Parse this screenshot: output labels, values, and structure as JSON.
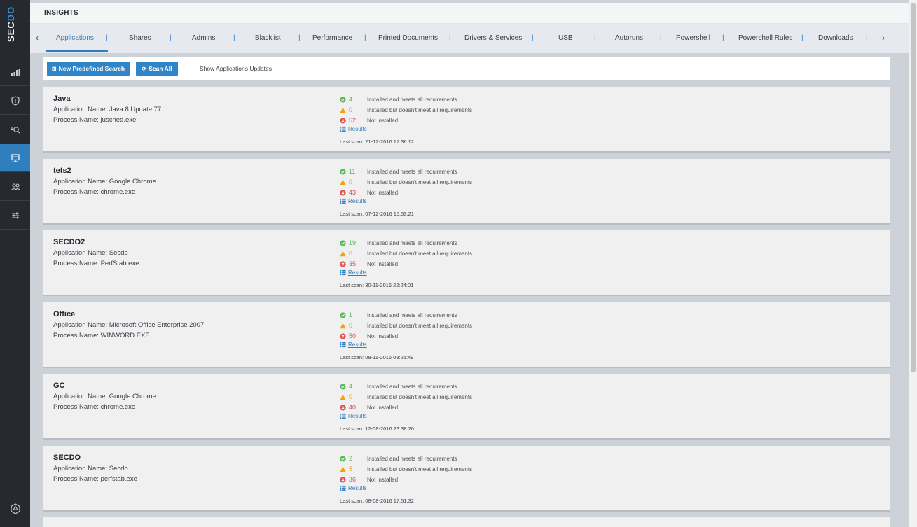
{
  "brand": {
    "logo_prefix": "SEC",
    "logo_suffix": "DO"
  },
  "header": {
    "title": "INSIGHTS"
  },
  "tabs": [
    {
      "label": "Applications"
    },
    {
      "label": "Shares"
    },
    {
      "label": "Admins"
    },
    {
      "label": "Blacklist"
    },
    {
      "label": "Performance"
    },
    {
      "label": "Printed Documents"
    },
    {
      "label": "Drivers & Services"
    },
    {
      "label": "USB"
    },
    {
      "label": "Autoruns"
    },
    {
      "label": "Powershell"
    },
    {
      "label": "Powershell Rules"
    },
    {
      "label": "Downloads"
    }
  ],
  "tab_separator": "|",
  "tab_arrows": {
    "left": "‹",
    "right": "›"
  },
  "toolbar": {
    "new_search_label": "New Predefined Search",
    "scan_all_label": "Scan All",
    "show_updates_label": "Show Applications Updates"
  },
  "labels": {
    "met": "Installed and meets all requirements",
    "partial": "Installed but doesn't meet all requirements",
    "missing": "Not installed",
    "results": "Results"
  },
  "cards": [
    {
      "title": "Java",
      "app_name": "Application Name: Java 8 Update 77",
      "process_name": "Process Name: jusched.exe",
      "met": "4",
      "partial": "0",
      "missing": "52",
      "last_scan": "Last scan: 21-12-2016 17:36:12"
    },
    {
      "title": "tets2",
      "app_name": "Application Name: Google Chrome",
      "process_name": "Process Name: chrome.exe",
      "met": "11",
      "partial": "0",
      "missing": "43",
      "last_scan": "Last scan: 07-12-2016 15:53:21"
    },
    {
      "title": "SECDO2",
      "app_name": "Application Name: Secdo",
      "process_name": "Process Name: PerfStab.exe",
      "met": "19",
      "partial": "0",
      "missing": "35",
      "last_scan": "Last scan: 30-11-2016 22:24:01"
    },
    {
      "title": "Office",
      "app_name": "Application Name: Microsoft Office Enterprise 2007",
      "process_name": "Process Name: WINWORD.EXE",
      "met": "1",
      "partial": "0",
      "missing": "50",
      "last_scan": "Last scan: 08-11-2016 09:25:49"
    },
    {
      "title": "GC",
      "app_name": "Application Name: Google Chrome",
      "process_name": "Process Name: chrome.exe",
      "met": "4",
      "partial": "0",
      "missing": "40",
      "last_scan": "Last scan: 12-08-2016 23:38:20"
    },
    {
      "title": "SECDO",
      "app_name": "Application Name: Secdo",
      "process_name": "Process Name: perfstab.exe",
      "met": "2",
      "partial": "5",
      "missing": "36",
      "last_scan": "Last scan: 08-08-2016 17:51:32"
    }
  ],
  "colors": {
    "accent": "#2f7ebe",
    "sidebar": "#262a30",
    "met": "#5cb85c",
    "partial": "#f0a30a",
    "missing": "#d9534f"
  },
  "sidebar_icons": [
    "signal-bars-icon",
    "shield-icon",
    "search-analytics-icon",
    "monitor-icon",
    "users-network-icon",
    "sliders-icon",
    "hexagon-logo-icon"
  ]
}
